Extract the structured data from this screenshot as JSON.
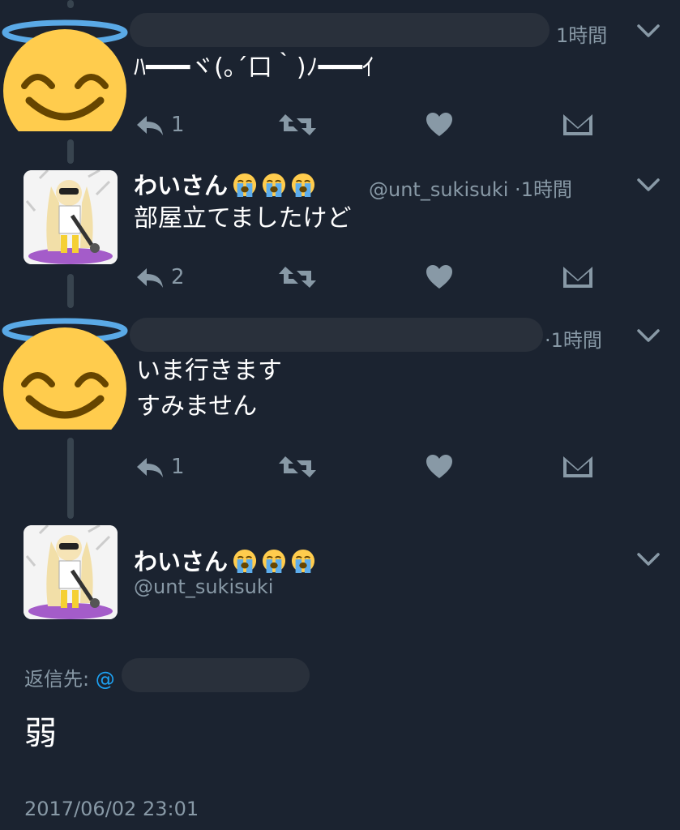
{
  "tweets": [
    {
      "author_hidden": true,
      "time": "1時間",
      "text": "ﾊ━━━ヾ(｡´口｀)ﾉ━━━ｲ",
      "reply_count": "1",
      "avatar": "halo-smile-emoji"
    },
    {
      "name": "わいさん",
      "handle": "@unt_sukisuki",
      "time_sep": "·",
      "time": "1時間",
      "text": "部屋立てましたけど",
      "reply_count": "2",
      "avatar": "anime-character-photo"
    },
    {
      "author_hidden": true,
      "time_sep": "·",
      "time": "1時間",
      "text": "いま行きます\nすみません",
      "reply_count": "1",
      "avatar": "halo-smile-emoji"
    }
  ],
  "main_tweet": {
    "name": "わいさん",
    "handle": "@unt_sukisuki",
    "reply_to_label": "返信先:",
    "reply_to_at": "@",
    "text": "弱",
    "timestamp": "2017/06/02 23:01"
  },
  "name_emoji": "loudly-crying-face-emoji",
  "icons": [
    "reply-icon",
    "retweet-icon",
    "like-icon",
    "dm-icon",
    "chevron-down-icon"
  ],
  "colors": {
    "background": "#1b2330",
    "secondary_text": "#8899a6",
    "link": "#1da1f2",
    "redaction": "#29303b",
    "thread_line": "#38444f"
  }
}
